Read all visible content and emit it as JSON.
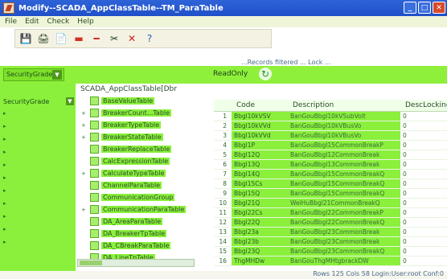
{
  "window": {
    "title": "Modify--SCADA_AppClassTable--TM_ParaTable",
    "minimize": "_",
    "maximize": "□",
    "close": "✕"
  },
  "menu": [
    "File",
    "Edit",
    "Check",
    "Help"
  ],
  "toolbar": {
    "buttons": [
      "save-icon",
      "print-icon",
      "copy-icon",
      "red-flag-icon",
      "delete-icon",
      "cut-icon",
      "cancel-icon",
      "help-icon"
    ]
  },
  "hint": "...Records filtered ... Lock ...",
  "filter": {
    "combo_value": "SecurityGrade",
    "readonly_label": "ReadOnly"
  },
  "left_panel": {
    "label": "SecurityGrade"
  },
  "tree": {
    "header": "SCADA_AppClassTable[Dbr",
    "items": [
      {
        "label": "BaseValueTable"
      },
      {
        "label": "BreakerCount...Table"
      },
      {
        "label": "BreakerTypeTable"
      },
      {
        "label": "BreakerStateTable"
      },
      {
        "label": "BreakerReplaceTable"
      },
      {
        "label": "CalcExpressionTable"
      },
      {
        "label": "CalculateTypeTable"
      },
      {
        "label": "ChannelParaTable"
      },
      {
        "label": "CommunicationGroup"
      },
      {
        "label": "CommunicationParaTable"
      },
      {
        "label": "DA_AreaParaTable"
      },
      {
        "label": "DA_BreakerTpTable"
      },
      {
        "label": "DA_CBreakParaTable"
      },
      {
        "label": "DA_LineTpTable"
      }
    ]
  },
  "grid": {
    "columns": [
      "",
      "Code",
      "Description",
      "DescLocking"
    ],
    "rows": [
      {
        "n": "1",
        "code": "Bbgl10kVSV",
        "desc": "BanGouBbgl10kVSubVolt",
        "dl": "0"
      },
      {
        "n": "2",
        "code": "Bbgl10kVVd",
        "desc": "BanGouBbgl10kVBusVo",
        "dl": "0"
      },
      {
        "n": "3",
        "code": "Bbgl10kVVd",
        "desc": "BanGouBbgl10kVBusVo",
        "dl": "0"
      },
      {
        "n": "4",
        "code": "Bbgl1P",
        "desc": "BanGouBbgl15CommonBreakP",
        "dl": "0"
      },
      {
        "n": "5",
        "code": "Bbgl12Q",
        "desc": "BanGouBbgl12CommonBreak",
        "dl": "0"
      },
      {
        "n": "6",
        "code": "Bbgl13Q",
        "desc": "BanGouBbgl13CommonBreak",
        "dl": "0"
      },
      {
        "n": "7",
        "code": "Bbgl14Q",
        "desc": "BanGouBbgl15CommonBreakQ",
        "dl": "0"
      },
      {
        "n": "8",
        "code": "Bbgl15Cs",
        "desc": "BanGouBbgl15CommonBreakQ",
        "dl": "0"
      },
      {
        "n": "9",
        "code": "Bbgl15Q",
        "desc": "BanGouBbgl15CommonBreakQ",
        "dl": "0"
      },
      {
        "n": "10",
        "code": "Bbgl21Q",
        "desc": "WeiHuBbgl21CommonBreakQ",
        "dl": "0"
      },
      {
        "n": "11",
        "code": "Bbgl22Cs",
        "desc": "BanGouBbgl22CommonBreakP",
        "dl": "0"
      },
      {
        "n": "12",
        "code": "Bbgl22Q",
        "desc": "BanGouBbgl22CommonBreakQ",
        "dl": "0"
      },
      {
        "n": "13",
        "code": "Bbgl23a",
        "desc": "BanGouBbgl23CommonBreak",
        "dl": "0"
      },
      {
        "n": "14",
        "code": "Bbgl23b",
        "desc": "BanGouBbgl23CommonBreak",
        "dl": "0"
      },
      {
        "n": "15",
        "code": "Bbgl23Q",
        "desc": "BanGouBbgl23CommonBreakQ",
        "dl": "0"
      },
      {
        "n": "16",
        "code": "ThgMHDw",
        "desc": "BanGouThgMHtgbrackDW",
        "dl": "0"
      }
    ]
  },
  "status": {
    "text": "Rows 125 Cols 58 Login:User:root Conf:0"
  }
}
